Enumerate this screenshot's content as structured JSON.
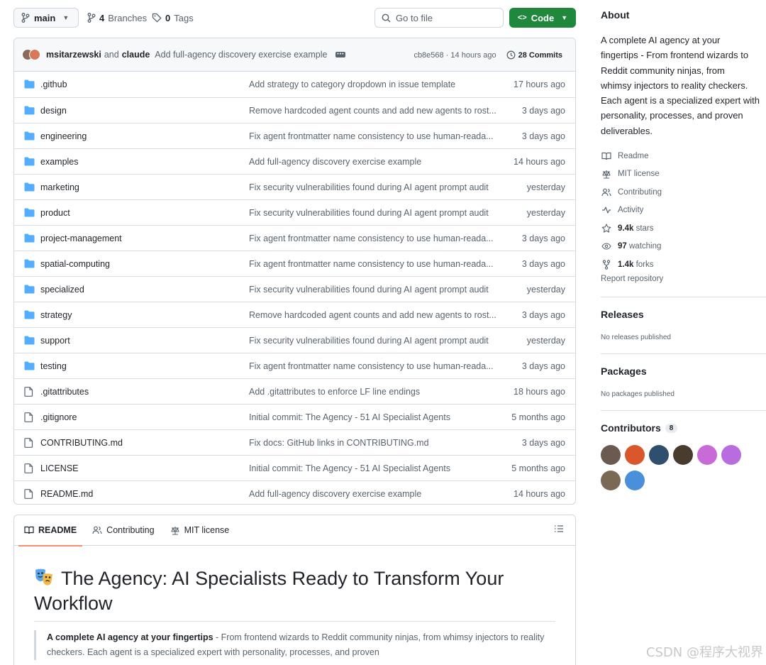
{
  "toolbar": {
    "branch": "main",
    "branches_count": "4",
    "branches_label": "Branches",
    "tags_count": "0",
    "tags_label": "Tags",
    "goto_placeholder": "Go to file",
    "code_label": "Code"
  },
  "commit": {
    "author1": "msitarzewski",
    "and": "and",
    "author2": "claude",
    "message": "Add full-agency discovery exercise example",
    "sha_time": "cb8e568 · 14 hours ago",
    "count": "28 Commits"
  },
  "files": [
    {
      "type": "folder",
      "name": ".github",
      "message": "Add strategy to category dropdown in issue template",
      "time": "17 hours ago"
    },
    {
      "type": "folder",
      "name": "design",
      "message": "Remove hardcoded agent counts and add new agents to rost...",
      "time": "3 days ago"
    },
    {
      "type": "folder",
      "name": "engineering",
      "message": "Fix agent frontmatter name consistency to use human-reada...",
      "time": "3 days ago"
    },
    {
      "type": "folder",
      "name": "examples",
      "message": "Add full-agency discovery exercise example",
      "time": "14 hours ago"
    },
    {
      "type": "folder",
      "name": "marketing",
      "message": "Fix security vulnerabilities found during AI agent prompt audit",
      "time": "yesterday"
    },
    {
      "type": "folder",
      "name": "product",
      "message": "Fix security vulnerabilities found during AI agent prompt audit",
      "time": "yesterday"
    },
    {
      "type": "folder",
      "name": "project-management",
      "message": "Fix agent frontmatter name consistency to use human-reada...",
      "time": "3 days ago"
    },
    {
      "type": "folder",
      "name": "spatial-computing",
      "message": "Fix agent frontmatter name consistency to use human-reada...",
      "time": "3 days ago"
    },
    {
      "type": "folder",
      "name": "specialized",
      "message": "Fix security vulnerabilities found during AI agent prompt audit",
      "time": "yesterday"
    },
    {
      "type": "folder",
      "name": "strategy",
      "message": "Remove hardcoded agent counts and add new agents to rost...",
      "time": "3 days ago"
    },
    {
      "type": "folder",
      "name": "support",
      "message": "Fix security vulnerabilities found during AI agent prompt audit",
      "time": "yesterday"
    },
    {
      "type": "folder",
      "name": "testing",
      "message": "Fix agent frontmatter name consistency to use human-reada...",
      "time": "3 days ago"
    },
    {
      "type": "file",
      "name": ".gitattributes",
      "message": "Add .gitattributes to enforce LF line endings",
      "time": "18 hours ago"
    },
    {
      "type": "file",
      "name": ".gitignore",
      "message": "Initial commit: The Agency - 51 AI Specialist Agents",
      "time": "5 months ago"
    },
    {
      "type": "file",
      "name": "CONTRIBUTING.md",
      "message": "Fix docs: GitHub links in CONTRIBUTING.md",
      "time": "3 days ago"
    },
    {
      "type": "file",
      "name": "LICENSE",
      "message": "Initial commit: The Agency - 51 AI Specialist Agents",
      "time": "5 months ago"
    },
    {
      "type": "file",
      "name": "README.md",
      "message": "Add full-agency discovery exercise example",
      "time": "14 hours ago"
    }
  ],
  "readme": {
    "tabs": [
      "README",
      "Contributing",
      "MIT license"
    ],
    "title": "The Agency: AI Specialists Ready to Transform Your Workflow",
    "quote_bold": "A complete AI agency at your fingertips",
    "quote_rest": " - From frontend wizards to Reddit community ninjas, from whimsy injectors to reality checkers. Each agent is a specialized expert with personality, processes, and proven"
  },
  "about": {
    "heading": "About",
    "description_lines": [
      "A complete AI agency at your",
      "fingertips - From frontend wizards to",
      "Reddit community ninjas, from",
      "whimsy injectors to reality checkers.",
      "Each agent is a specialized expert with",
      "personality, processes, and proven",
      "deliverables."
    ],
    "links": {
      "readme": "Readme",
      "license": "MIT license",
      "contributing": "Contributing",
      "activity": "Activity",
      "stars_count": "9.4k",
      "stars_label": "stars",
      "watching_count": "97",
      "watching_label": "watching",
      "forks_count": "1.4k",
      "forks_label": "forks"
    },
    "report": "Report repository"
  },
  "releases": {
    "heading": "Releases",
    "empty": "No releases published"
  },
  "packages": {
    "heading": "Packages",
    "empty": "No packages published"
  },
  "contributors": {
    "heading": "Contributors",
    "count": "8",
    "avatar_colors": [
      "#6b5a50",
      "#d9572b",
      "#2f4f6f",
      "#4a3b2f",
      "#c86bd6",
      "#b96be0",
      "#7a6a55",
      "#4a8fd9"
    ]
  },
  "colors": {
    "accent_green": "#1f883d",
    "folder_blue": "#54aeff",
    "tab_underline": "#fd8c73"
  },
  "watermark": "CSDN @程序大视界"
}
